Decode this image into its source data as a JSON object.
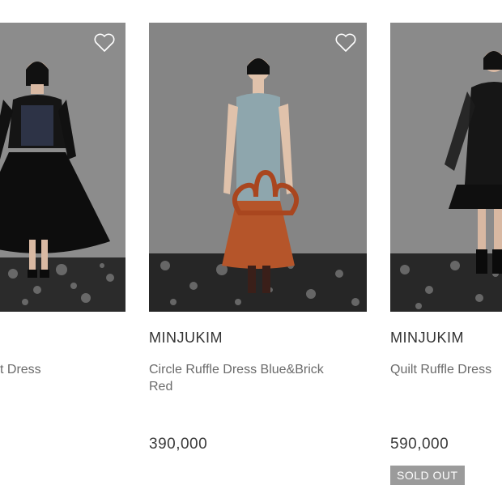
{
  "products": [
    {
      "brand": "",
      "name": "t Dress",
      "price": "",
      "sold_out": "",
      "wishlist_icon": "heart-outline-icon"
    },
    {
      "brand": "MINJUKIM",
      "name": "Circle Ruffle Dress Blue&Brick Red",
      "price": "390,000",
      "sold_out": "",
      "wishlist_icon": "heart-outline-icon"
    },
    {
      "brand": "MINJUKIM",
      "name": "Quilt Ruffle Dress",
      "price": "590,000",
      "sold_out": "SOLD OUT",
      "wishlist_icon": ""
    }
  ]
}
